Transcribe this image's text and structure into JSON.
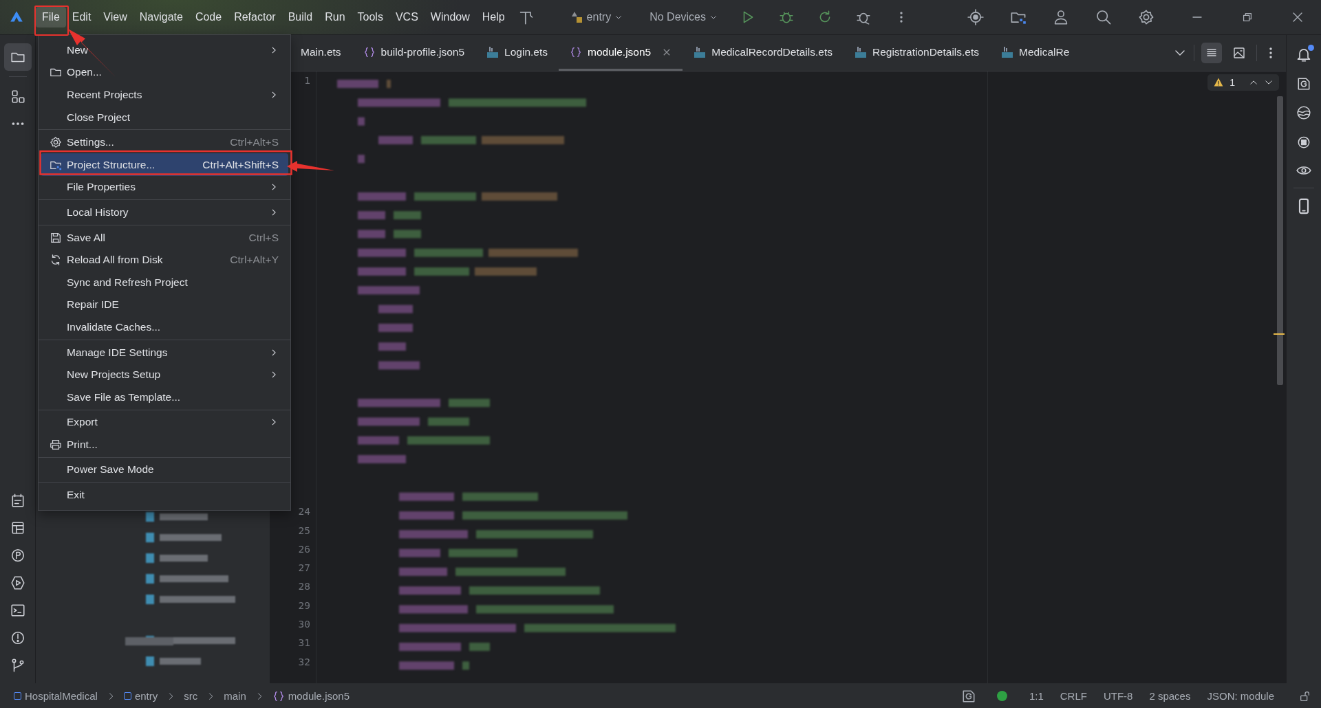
{
  "menu_bar": [
    {
      "label": "File",
      "selected": true
    },
    {
      "label": "Edit",
      "selected": false
    },
    {
      "label": "View",
      "selected": false
    },
    {
      "label": "Navigate",
      "selected": false
    },
    {
      "label": "Code",
      "selected": false
    },
    {
      "label": "Refactor",
      "selected": false
    },
    {
      "label": "Build",
      "selected": false
    },
    {
      "label": "Run",
      "selected": false
    },
    {
      "label": "Tools",
      "selected": false
    },
    {
      "label": "VCS",
      "selected": false
    },
    {
      "label": "Window",
      "selected": false
    },
    {
      "label": "Help",
      "selected": false
    }
  ],
  "toolbar": {
    "run_config": "entry",
    "device": "No Devices"
  },
  "tabs": [
    {
      "label": "Main.ets",
      "kind": "plain",
      "selected": false
    },
    {
      "label": "build-profile.json5",
      "kind": "json",
      "selected": false
    },
    {
      "label": "Login.ets",
      "kind": "ets",
      "selected": false
    },
    {
      "label": "module.json5",
      "kind": "json",
      "selected": true,
      "closable": true
    },
    {
      "label": "MedicalRecordDetails.ets",
      "kind": "ets",
      "selected": false
    },
    {
      "label": "RegistrationDetails.ets",
      "kind": "ets",
      "selected": false
    },
    {
      "label": "MedicalRe",
      "kind": "ets",
      "selected": false
    }
  ],
  "file_menu": {
    "groups": [
      [
        {
          "label": "New",
          "kind": "plain",
          "submenu": true,
          "selected": false
        },
        {
          "label": "Open...",
          "kind": "folder",
          "selected": false
        },
        {
          "label": "Recent Projects",
          "kind": "plain",
          "submenu": true,
          "selected": false
        },
        {
          "label": "Close Project",
          "kind": "plain",
          "selected": false
        }
      ],
      [
        {
          "label": "Settings...",
          "kind": "gear",
          "shortcut": "Ctrl+Alt+S",
          "selected": false
        },
        {
          "label": "Project Structure...",
          "kind": "structure",
          "shortcut": "Ctrl+Alt+Shift+S",
          "selected": true
        },
        {
          "label": "File Properties",
          "kind": "plain",
          "submenu": true,
          "selected": false
        }
      ],
      [
        {
          "label": "Local History",
          "kind": "plain",
          "submenu": true,
          "selected": false
        }
      ],
      [
        {
          "label": "Save All",
          "kind": "save",
          "shortcut": "Ctrl+S",
          "selected": false
        },
        {
          "label": "Reload All from Disk",
          "kind": "reload",
          "shortcut": "Ctrl+Alt+Y",
          "selected": false
        },
        {
          "label": "Sync and Refresh Project",
          "kind": "plain",
          "selected": false
        },
        {
          "label": "Repair IDE",
          "kind": "plain",
          "selected": false
        },
        {
          "label": "Invalidate Caches...",
          "kind": "plain",
          "selected": false
        }
      ],
      [
        {
          "label": "Manage IDE Settings",
          "kind": "plain",
          "submenu": true,
          "selected": false
        },
        {
          "label": "New Projects Setup",
          "kind": "plain",
          "submenu": true,
          "selected": false
        },
        {
          "label": "Save File as Template...",
          "kind": "plain",
          "selected": false
        }
      ],
      [
        {
          "label": "Export",
          "kind": "plain",
          "submenu": true,
          "selected": false
        },
        {
          "label": "Print...",
          "kind": "print",
          "selected": false
        }
      ],
      [
        {
          "label": "Power Save Mode",
          "kind": "plain",
          "selected": false
        }
      ],
      [
        {
          "label": "Exit",
          "kind": "plain",
          "selected": false
        }
      ]
    ]
  },
  "editor": {
    "first_line": "1",
    "line_numbers": [
      "24",
      "25",
      "26",
      "27",
      "28",
      "29",
      "30",
      "31",
      "32"
    ],
    "warning_count": "1"
  },
  "notifications": {
    "unread": true
  },
  "breadcrumbs": [
    {
      "label": "HospitalMedical",
      "kind": "module"
    },
    {
      "label": "entry",
      "kind": "module"
    },
    {
      "label": "src",
      "kind": "plain"
    },
    {
      "label": "main",
      "kind": "plain"
    },
    {
      "label": "module.json5",
      "kind": "json"
    }
  ],
  "status_bar": [
    "1:1",
    "CRLF",
    "UTF-8",
    "2 spaces",
    "JSON: module"
  ]
}
